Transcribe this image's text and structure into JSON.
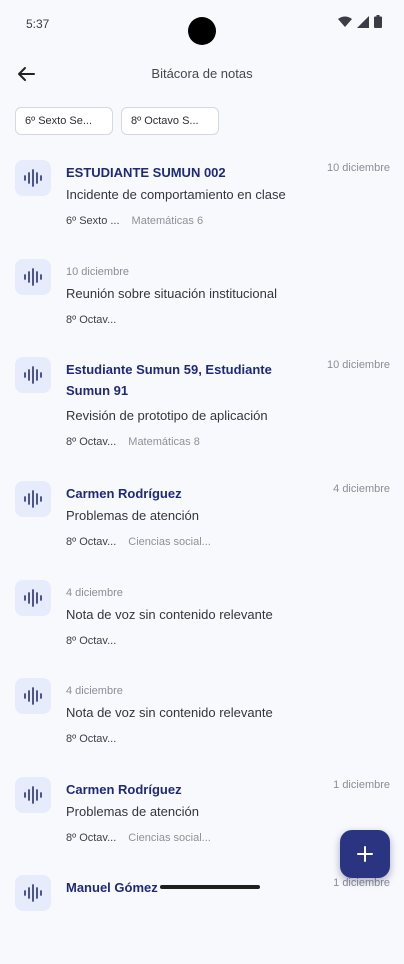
{
  "status": {
    "time": "5:37"
  },
  "appbar": {
    "title": "Bitácora de notas"
  },
  "chips": [
    "6º Sexto Se...",
    "8º Octavo S..."
  ],
  "notes": [
    {
      "heading": "ESTUDIANTE SUMUN 002",
      "date": "10 diciembre",
      "title": "Incidente de comportamiento en clase",
      "group": "6º Sexto ...",
      "subject": "Matemáticas 6"
    },
    {
      "heading": "10 diciembre",
      "date": "",
      "title": "Reunión sobre situación institucional",
      "group": "8º Octav...",
      "subject": ""
    },
    {
      "heading": "Estudiante Sumun 59, Estudiante Sumun 91",
      "date": "10 diciembre",
      "title": "Revisión de prototipo de aplicación",
      "group": "8º Octav...",
      "subject": "Matemáticas 8"
    },
    {
      "heading": "Carmen Rodríguez",
      "date": "4 diciembre",
      "title": "Problemas de atención",
      "group": "8º Octav...",
      "subject": "Ciencias social..."
    },
    {
      "heading": "4 diciembre",
      "date": "",
      "title": "Nota de voz sin contenido relevante",
      "group": "8º Octav...",
      "subject": ""
    },
    {
      "heading": "4 diciembre",
      "date": "",
      "title": "Nota de voz sin contenido relevante",
      "group": "8º Octav...",
      "subject": ""
    },
    {
      "heading": "Carmen Rodríguez",
      "date": "1 diciembre",
      "title": "Problemas de atención",
      "group": "8º Octav...",
      "subject": "Ciencias social..."
    },
    {
      "heading": "Manuel Gómez",
      "date": "1 diciembre",
      "title": "",
      "group": "",
      "subject": ""
    }
  ],
  "icons": {
    "back": "arrow-left-icon",
    "note": "voice-wave-icon",
    "fab": "plus-icon"
  },
  "colors": {
    "accent": "#2b3480",
    "heading": "#1e2a78",
    "icon_bg": "#e6ecfb",
    "background": "#f8f9fd"
  }
}
